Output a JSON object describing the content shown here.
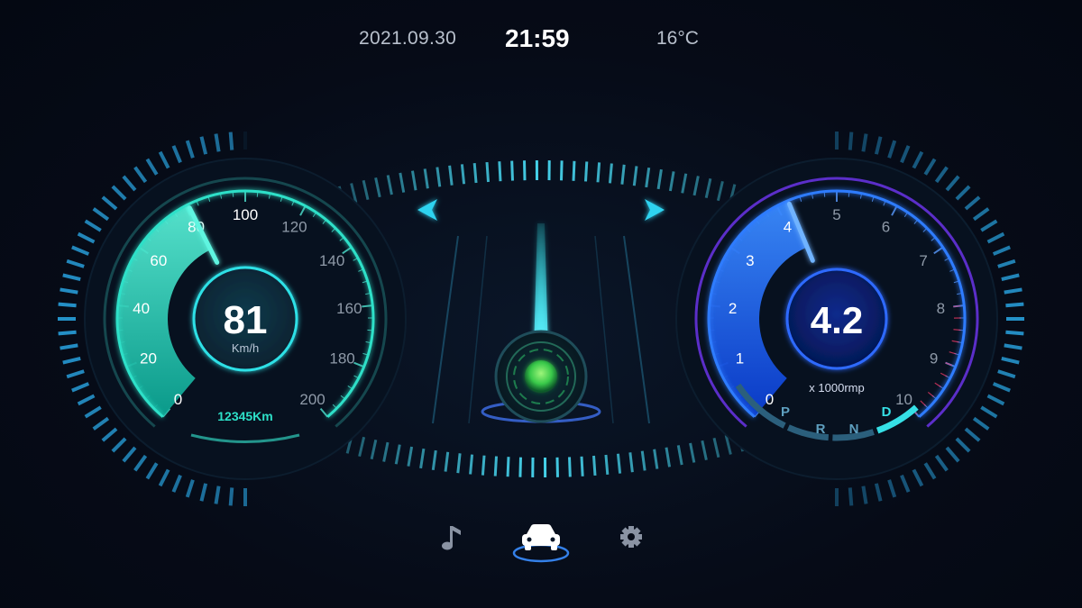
{
  "status": {
    "date": "2021.09.30",
    "time": "21:59",
    "temperature": "16°C"
  },
  "speedometer": {
    "ticks": [
      "0",
      "20",
      "40",
      "60",
      "80",
      "100",
      "120",
      "140",
      "160",
      "180",
      "200"
    ],
    "value": 81,
    "max": 200,
    "value_text": "81",
    "unit": "Km/h",
    "odometer": "12345Km"
  },
  "tachometer": {
    "ticks": [
      "0",
      "1",
      "2",
      "3",
      "4",
      "5",
      "6",
      "7",
      "8",
      "9",
      "10"
    ],
    "value": 4.2,
    "max": 10,
    "value_text": "4.2",
    "unit": "x 1000rmp"
  },
  "gears": [
    {
      "label": "P",
      "active": false
    },
    {
      "label": "R",
      "active": false
    },
    {
      "label": "N",
      "active": false
    },
    {
      "label": "D",
      "active": true
    }
  ],
  "bottom_nav": [
    {
      "icon": "music-note-icon",
      "active": false
    },
    {
      "icon": "car-icon",
      "active": true
    },
    {
      "icon": "gear-icon",
      "active": false
    }
  ],
  "colors": {
    "speed_accent": "#2de0c8",
    "rpm_accent": "#2e7bff",
    "active_gear": "#36e0e6"
  }
}
